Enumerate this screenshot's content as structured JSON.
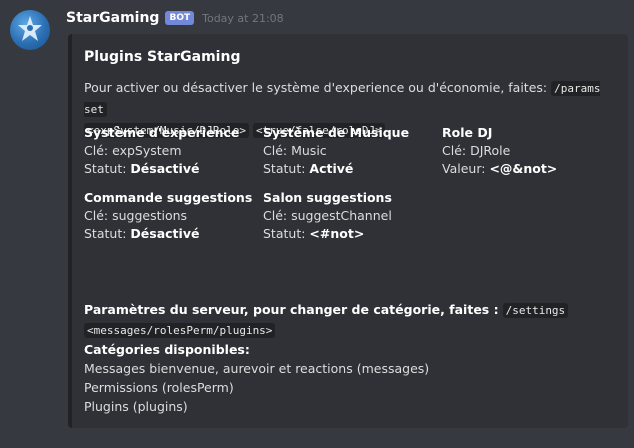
{
  "message": {
    "username": "StarGaming",
    "bot_tag": "BOT",
    "timestamp": "Today at 21:08",
    "avatar_icon": "star-figure-avatar-icon"
  },
  "embed": {
    "title": "Plugins StarGaming",
    "description_text": "Pour activer ou désactiver le système d'experience ou d'économie, faites:",
    "description_code_1": "/params set",
    "description_code_2": "<expSystem/Music/DJRole>",
    "description_code_3": "<true/false/roleDJ>",
    "fields": [
      {
        "name": "Système d'experience",
        "line1_label": "Clé:",
        "line1_value": "expSystem",
        "line2_label": "Statut:",
        "line2_value": "Désactivé"
      },
      {
        "name": "Système de Musique",
        "line1_label": "Clé:",
        "line1_value": "Music",
        "line2_label": "Statut:",
        "line2_value": "Activé"
      },
      {
        "name": "Role DJ",
        "line1_label": "Clé:",
        "line1_value": "DJRole",
        "line2_label": "Valeur:",
        "line2_value": "<@&not>"
      },
      {
        "name": "Commande suggestions",
        "line1_label": "Clé:",
        "line1_value": "suggestions",
        "line2_label": "Statut:",
        "line2_value": "Désactivé"
      },
      {
        "name": "Salon suggestions",
        "line1_label": "Clé:",
        "line1_value": "suggestChannel",
        "line2_label": "Statut:",
        "line2_value": "<#not>"
      }
    ],
    "settings_text": "Paramètres du serveur, pour changer de catégorie, faites :",
    "settings_code_1": "/settings",
    "settings_code_2": "<messages/rolesPerm/plugins>",
    "categories_title": "Catégories disponibles:",
    "categories": [
      "Messages bienvenue, aurevoir et reactions (messages)",
      "Permissions (rolesPerm)",
      "Plugins (plugins)"
    ]
  },
  "colors": {
    "background": "#36393f",
    "embed_background": "#2f3136",
    "bot_tag": "#7289da"
  }
}
